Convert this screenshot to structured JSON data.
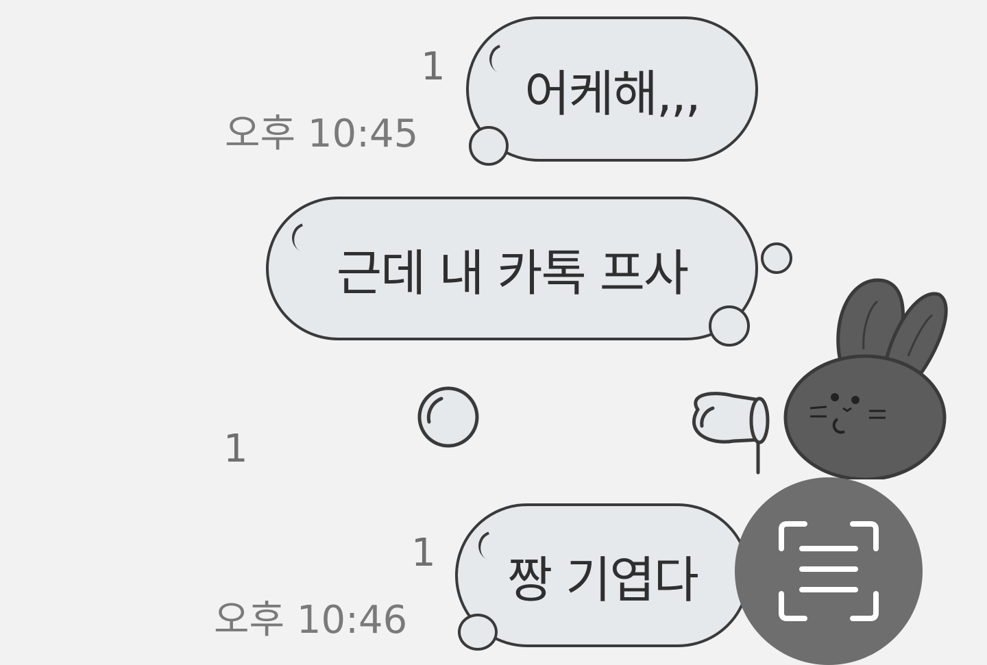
{
  "chat": {
    "messages": [
      {
        "text": "어케해,,,",
        "read_count": "1",
        "time": "오후 10:45"
      },
      {
        "text": "근데 내 카톡 프사"
      },
      {
        "type": "sticker",
        "sticker_name": "rabbit-blowing-bubble-sticker",
        "read_count": "1"
      },
      {
        "text": "짱 기엽다",
        "read_count": "1",
        "time": "오후 10:46"
      }
    ]
  },
  "floating_button": {
    "icon": "text-scan-icon"
  },
  "colors": {
    "background": "#f2f2f2",
    "bubble_fill": "#e5e9ec",
    "bubble_outline": "#3a3a3a",
    "meta_text": "#7a7a7a",
    "scan_button": "#6e6e6e"
  }
}
